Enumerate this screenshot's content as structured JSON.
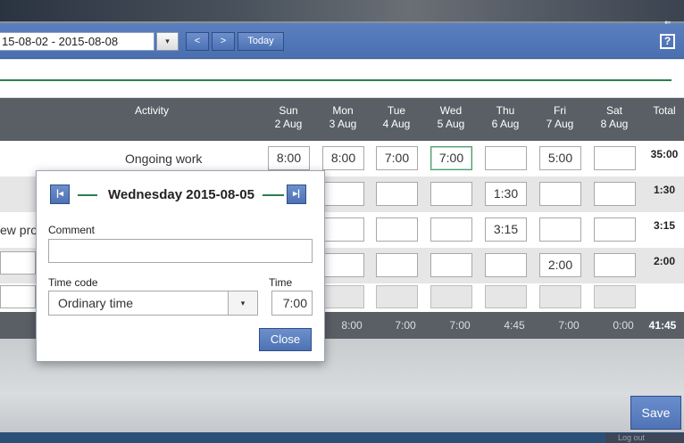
{
  "toolbar": {
    "date_range": "15-08-02  -  2015-08-08",
    "dropdown_arrow": "▾",
    "prev": "<",
    "next": ">",
    "today": "Today",
    "help": "?",
    "collapse_icon": "⇐"
  },
  "table": {
    "activity_header": "Activity",
    "total_header": "Total",
    "days": [
      {
        "name": "Sun",
        "date": "2 Aug"
      },
      {
        "name": "Mon",
        "date": "3 Aug"
      },
      {
        "name": "Tue",
        "date": "4 Aug"
      },
      {
        "name": "Wed",
        "date": "5 Aug"
      },
      {
        "name": "Thu",
        "date": "6 Aug"
      },
      {
        "name": "Fri",
        "date": "7 Aug"
      },
      {
        "name": "Sat",
        "date": "8 Aug"
      }
    ],
    "rows": [
      {
        "label": "Ongoing work",
        "cells": [
          "8:00",
          "8:00",
          "7:00",
          "7:00",
          "",
          "5:00",
          ""
        ],
        "total": "35:00"
      },
      {
        "label": "",
        "cells": [
          "",
          "",
          "",
          "",
          "1:30",
          "",
          ""
        ],
        "total": "1:30"
      },
      {
        "label": "ew prog",
        "cells": [
          "",
          "",
          "",
          "",
          "3:15",
          "",
          ""
        ],
        "total": "3:15"
      },
      {
        "label": "",
        "cells": [
          "",
          "",
          "",
          "",
          "",
          "2:00",
          ""
        ],
        "total": "2:00"
      },
      {
        "label": "",
        "cells": [
          "",
          "",
          "",
          "",
          "",
          "",
          ""
        ],
        "total": ""
      }
    ],
    "day_totals": [
      "",
      "8:00",
      "7:00",
      "7:00",
      "4:45",
      "7:00",
      "0:00"
    ],
    "grand_total": "41:45"
  },
  "popup": {
    "title": "Wednesday 2015-08-05",
    "prev_icon": "|◂",
    "next_icon": "▸|",
    "comment_label": "Comment",
    "comment_value": "",
    "timecode_label": "Time code",
    "timecode_value": "Ordinary time",
    "timecode_arrow": "▾",
    "time_label": "Time",
    "time_value": "7:00",
    "close": "Close"
  },
  "footer": {
    "save": "Save",
    "logout": "Log out"
  },
  "colors": {
    "accent": "#4f73b5",
    "header": "#5a5f66",
    "green": "#2e7d4f"
  }
}
